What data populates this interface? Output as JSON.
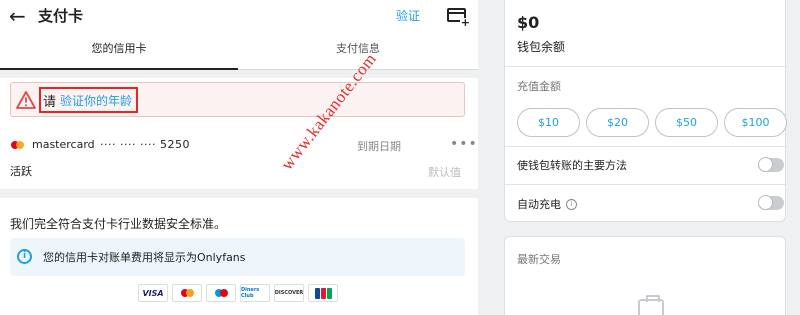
{
  "header": {
    "back_icon": "back-arrow-icon",
    "title": "支付卡",
    "verify_link": "验证",
    "add_card_icon": "add-card-icon"
  },
  "tabs": [
    {
      "label": "您的信用卡",
      "active": true
    },
    {
      "label": "支付信息",
      "active": false
    }
  ],
  "warning": {
    "icon": "warning-triangle-icon",
    "prefix": "请",
    "link": "验证你的年龄"
  },
  "card": {
    "brand": "mastercard",
    "number": "···· ···· ···· 5250",
    "expiry_label": "到期日期",
    "status": "活跃",
    "default_label": "默认值",
    "more_icon": "more-horizontal-icon"
  },
  "security": {
    "text": "我们完全符合支付卡行业数据安全标准。",
    "statement_note": "您的信用卡对账单费用将显示为Onlyfans",
    "logos": [
      {
        "name": "VISA"
      },
      {
        "name": "MasterCard"
      },
      {
        "name": "Maestro"
      },
      {
        "name": "Diners Club"
      },
      {
        "name": "DISCOVER"
      },
      {
        "name": "JCB"
      }
    ]
  },
  "wallet": {
    "balance": "$0",
    "balance_label": "钱包余额",
    "topup_label": "充值金额",
    "amounts": [
      "$10",
      "$20",
      "$50",
      "$100"
    ],
    "primary_method_label": "使钱包转账的主要方法",
    "primary_method_on": false,
    "auto_recharge_label": "自动充电",
    "auto_recharge_on": false
  },
  "transactions": {
    "title": "最新交易"
  },
  "watermark": "www.kakanote.com",
  "colors": {
    "accent": "#1e9fe4",
    "warning_border": "#e52626",
    "watermark": "#e0302a"
  }
}
